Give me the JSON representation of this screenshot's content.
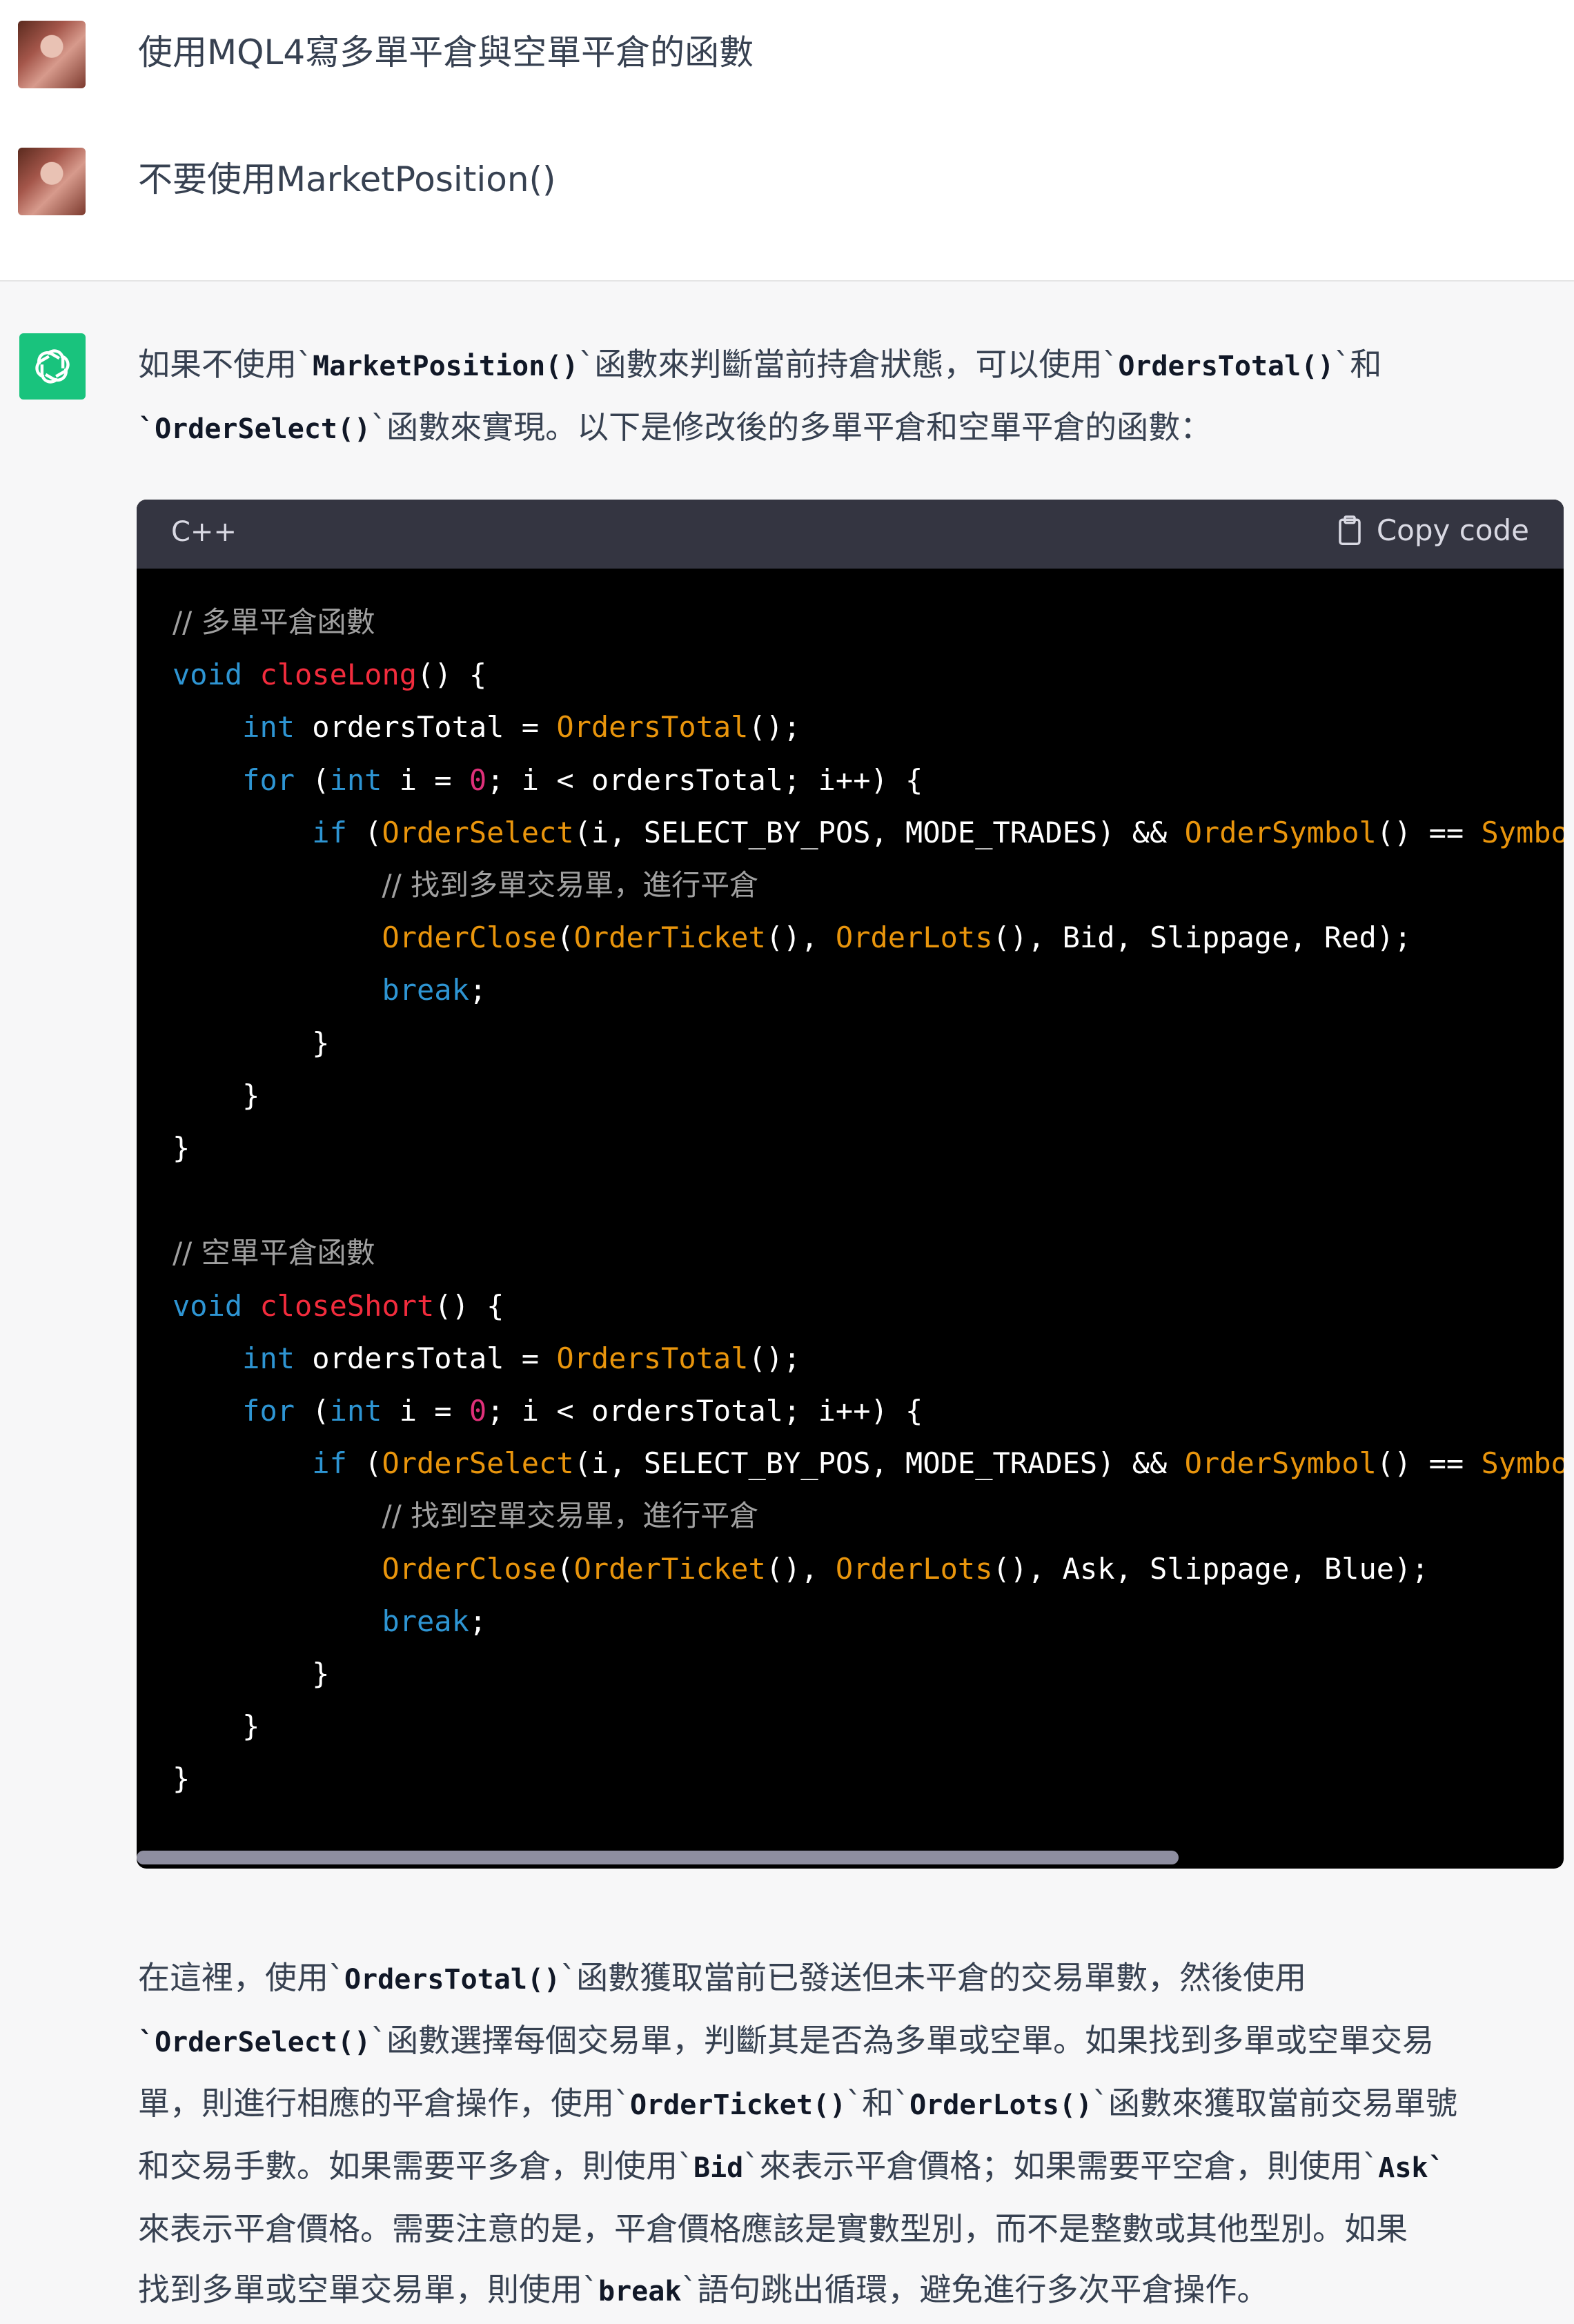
{
  "user_messages": [
    {
      "text": "使用MQL4寫多單平倉與空單平倉的函數"
    },
    {
      "text": "不要使用MarketPosition()"
    }
  ],
  "assistant": {
    "intro": {
      "t1": "如果不使用`",
      "c1": "MarketPosition()",
      "t2": "`函數來判斷當前持倉狀態，可以使用`",
      "c2": "OrdersTotal()",
      "t3": "`和",
      "c3": "`OrderSelect()",
      "t4": "`函數來實現。以下是修改後的多單平倉和空單平倉的函數："
    },
    "code_block": {
      "language": "C++",
      "copy_label": "Copy code",
      "long_comment": "// 多單平倉函數",
      "long_inner_comment": "// 找到多單交易單，進行平倉",
      "short_comment": "// 空單平倉函數",
      "short_inner_comment": "// 找到空單交易單，進行平倉",
      "long_fn_name": "closeLong",
      "short_fn_name": "closeShort",
      "long_close_args": "Bid, Slippage, Red",
      "short_close_args": "Ask, Slippage, Blue"
    },
    "explanation": {
      "l1a": "在這裡，使用`",
      "l1c": "OrdersTotal()",
      "l1b": "`函數獲取當前已發送但未平倉的交易單數，然後使用",
      "l2c": "`OrderSelect()",
      "l2b": "`函數選擇每個交易單，判斷其是否為多單或空單。如果找到多單或空單交易",
      "l3a": "單，則進行相應的平倉操作，使用`",
      "l3c1": "OrderTicket()",
      "l3b": "`和`",
      "l3c2": "OrderLots()",
      "l3d": "`函數來獲取當前交易單號",
      "l4a": "和交易手數。如果需要平多倉，則使用`",
      "l4c1": "Bid",
      "l4b": "`來表示平倉價格；如果需要平空倉，則使用`",
      "l4c2": "Ask`",
      "l5": "來表示平倉價格。需要注意的是，平倉價格應該是實數型別，而不是整數或其他型別。如果",
      "l6a": "找到多單或空單交易單，則使用`",
      "l6c": "break",
      "l6b": "`語句跳出循環，避免進行多次平倉操作。"
    }
  }
}
